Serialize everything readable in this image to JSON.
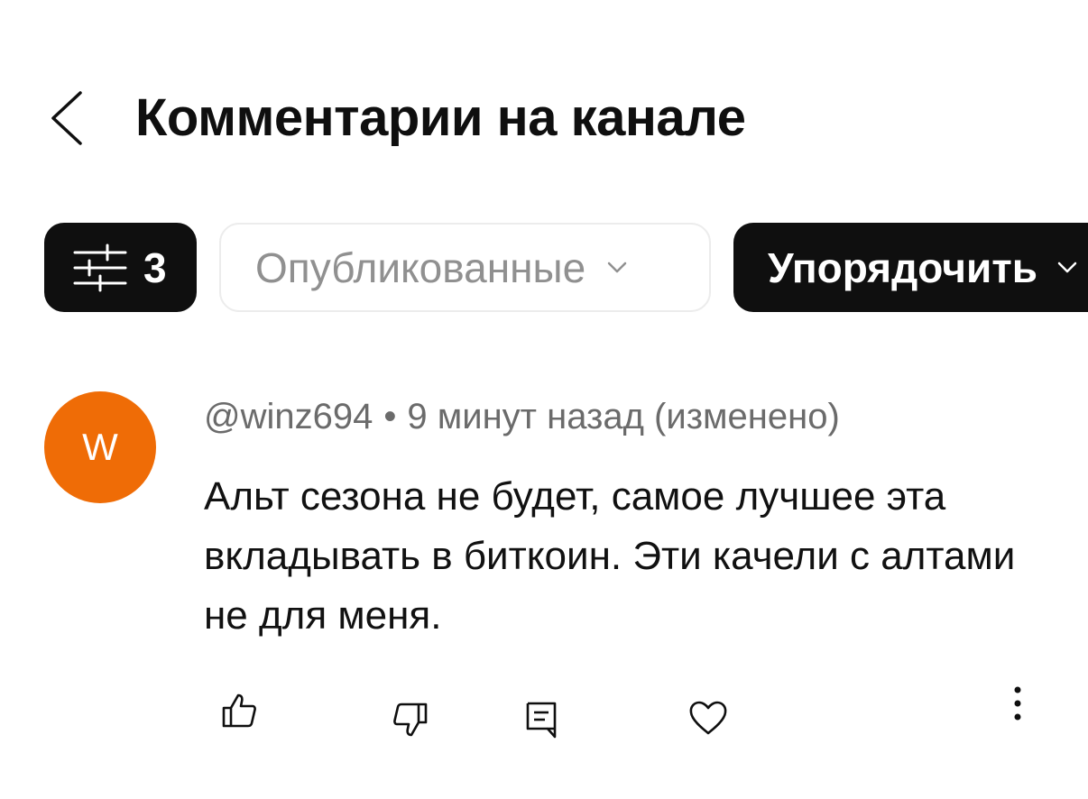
{
  "header": {
    "back_icon": "chevron-left-icon",
    "title": "Комментарии на канале"
  },
  "filters": {
    "filter_chip": {
      "icon": "sliders-icon",
      "count": "3"
    },
    "status_chip": {
      "label": "Опубликованные",
      "icon": "chevron-down-icon"
    },
    "sort_chip": {
      "label": "Упорядочить",
      "icon": "chevron-down-icon"
    }
  },
  "comment": {
    "avatar_letter": "W",
    "avatar_color": "#ef6c06",
    "author": "@winz694",
    "separator": "•",
    "time": "9 минут назад (изменено)",
    "text": "Альт сезона не будет, самое лучшее эта вкладывать в биткоин. Эти качели с алтами не для меня.",
    "actions": [
      "thumbs-up-icon",
      "thumbs-down-icon",
      "reply-icon",
      "heart-icon",
      "more-vertical-icon"
    ]
  }
}
